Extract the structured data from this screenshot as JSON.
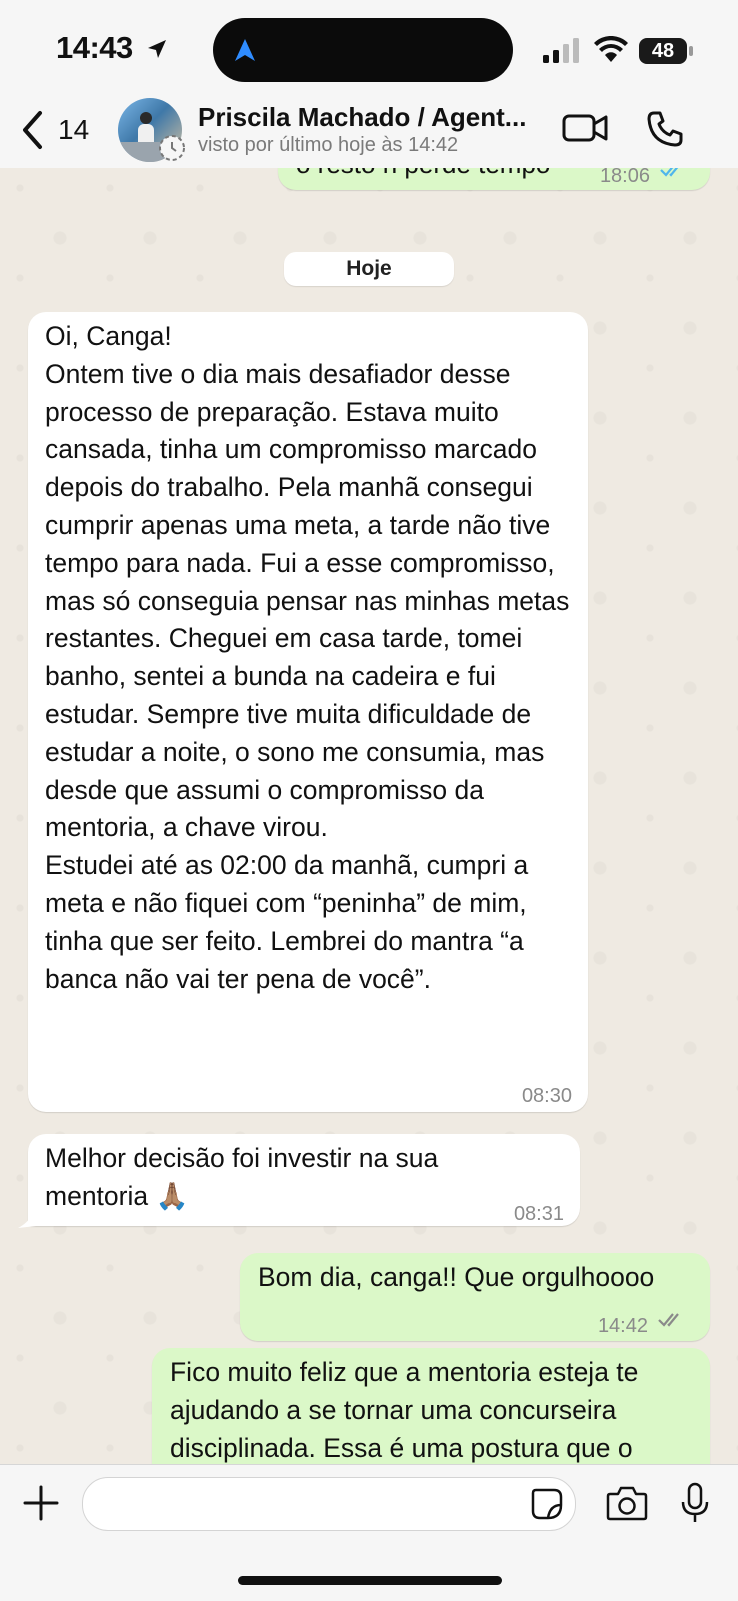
{
  "status_bar": {
    "time": "14:43",
    "battery": "48"
  },
  "header": {
    "back_count": "14",
    "contact_name": "Priscila Machado / Agent...",
    "last_seen": "visto por último hoje às 14:42"
  },
  "chat": {
    "top_partial": {
      "text": "o resto n perde tempo",
      "time": "18:06"
    },
    "date_divider": "Hoje",
    "messages": [
      {
        "direction": "in",
        "text": "Oi, Canga!\nOntem tive o dia mais desafiador desse processo de preparação. Estava muito cansada, tinha um compromisso marcado depois do trabalho. Pela manhã consegui cumprir apenas uma meta, a tarde não tive tempo para nada. Fui a esse compromisso, mas só conseguia pensar nas minhas metas restantes. Cheguei em casa tarde, tomei banho, sentei a bunda na cadeira e fui estudar. Sempre tive muita dificuldade de estudar a noite, o sono me consumia, mas desde que assumi o compromisso da mentoria, a chave virou.\nEstudei até as 02:00 da manhã, cumpri a meta e não fiquei com “peninha” de mim, tinha que ser feito. Lembrei do mantra “a banca não vai ter pena de você”.",
        "time": "08:30"
      },
      {
        "direction": "in",
        "text": "Melhor decisão foi investir na sua mentoria 🙏🏽",
        "time": "08:31"
      },
      {
        "direction": "out",
        "text": "Bom dia, canga!! Que orgulhoooo",
        "time": "14:42"
      },
      {
        "direction": "out",
        "text": "Fico muito feliz que a mentoria esteja te ajudando a se tornar uma concurseira disciplinada. Essa é uma postura que o",
        "time": ""
      }
    ]
  },
  "composer": {
    "placeholder": ""
  },
  "colors": {
    "incoming_bubble": "#ffffff",
    "outgoing_bubble": "#dbf8c8",
    "read_ticks": "#4fb6ec"
  }
}
